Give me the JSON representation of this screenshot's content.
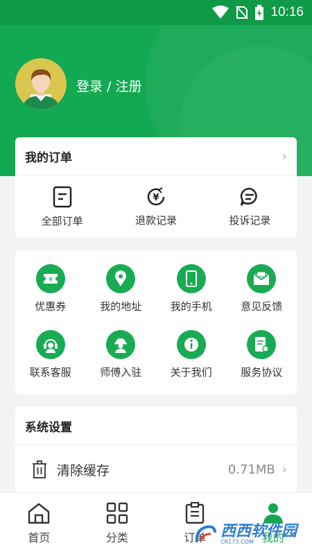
{
  "status_bar": {
    "time": "10:16"
  },
  "header": {
    "login_text": "登录 / 注册"
  },
  "orders": {
    "title": "我的订单",
    "items": [
      {
        "label": "全部订单",
        "icon": "order-list-icon"
      },
      {
        "label": "退款记录",
        "icon": "refund-icon"
      },
      {
        "label": "投诉记录",
        "icon": "complaint-icon"
      }
    ]
  },
  "services": {
    "items": [
      {
        "label": "优惠券",
        "icon": "coupon-icon"
      },
      {
        "label": "我的地址",
        "icon": "location-icon"
      },
      {
        "label": "我的手机",
        "icon": "phone-icon"
      },
      {
        "label": "意见反馈",
        "icon": "feedback-icon"
      },
      {
        "label": "联系客服",
        "icon": "customer-service-icon"
      },
      {
        "label": "师傅入驻",
        "icon": "worker-icon"
      },
      {
        "label": "关于我们",
        "icon": "info-icon"
      },
      {
        "label": "服务协议",
        "icon": "agreement-icon"
      }
    ]
  },
  "settings": {
    "title": "系统设置",
    "clear_cache_label": "清除缓存",
    "cache_size": "0.71MB"
  },
  "tabbar": {
    "items": [
      {
        "label": "首页",
        "icon": "home-icon"
      },
      {
        "label": "分类",
        "icon": "grid-icon"
      },
      {
        "label": "订单",
        "icon": "clipboard-icon"
      },
      {
        "label": "我的",
        "icon": "user-icon"
      }
    ]
  },
  "colors": {
    "brand_green": "#13a852",
    "status_green": "#0e9a47"
  },
  "watermark": {
    "text": "西西软件园",
    "sub": "CR173.COM"
  }
}
